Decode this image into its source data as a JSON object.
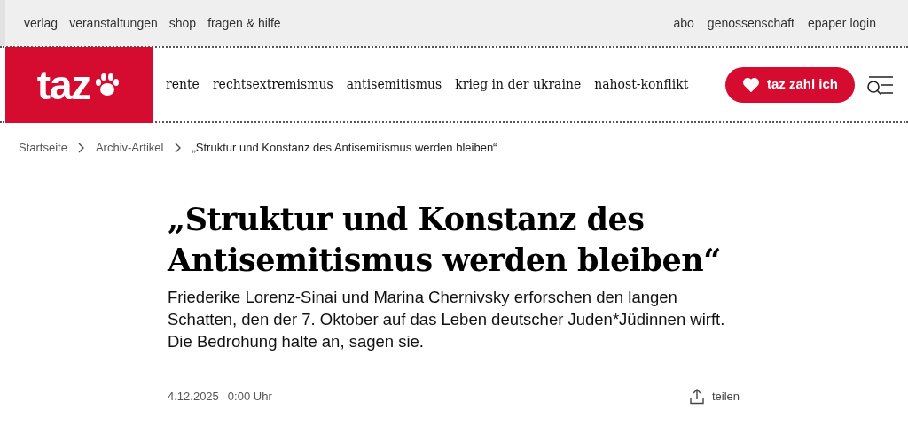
{
  "top_links_left": [
    "verlag",
    "veranstaltungen",
    "shop",
    "fragen & hilfe"
  ],
  "top_links_right": [
    "abo",
    "genossenschaft",
    "epaper login"
  ],
  "logo": "taz",
  "nav": [
    "rente",
    "rechtsextremismus",
    "antisemitismus",
    "krieg in der ukraine",
    "nahost-konflikt"
  ],
  "support_button": "taz zahl ich",
  "breadcrumb": [
    "Startseite",
    "Archiv-Artikel",
    "„Struktur und Konstanz des Antisemitismus werden bleiben“"
  ],
  "article": {
    "title": "„Struktur und Konstanz des Antisemitismus werden bleiben“",
    "teaser": "Friederike Lorenz-Sinai und Marina Chernivsky erforschen den langen Schatten, den der 7. Oktober auf das Leben deutscher Juden*Jüdinnen wirft. Die Bedrohung halte an, sagen sie.",
    "date": "4.12.2025",
    "time": "0:00 Uhr",
    "share": "teilen"
  }
}
